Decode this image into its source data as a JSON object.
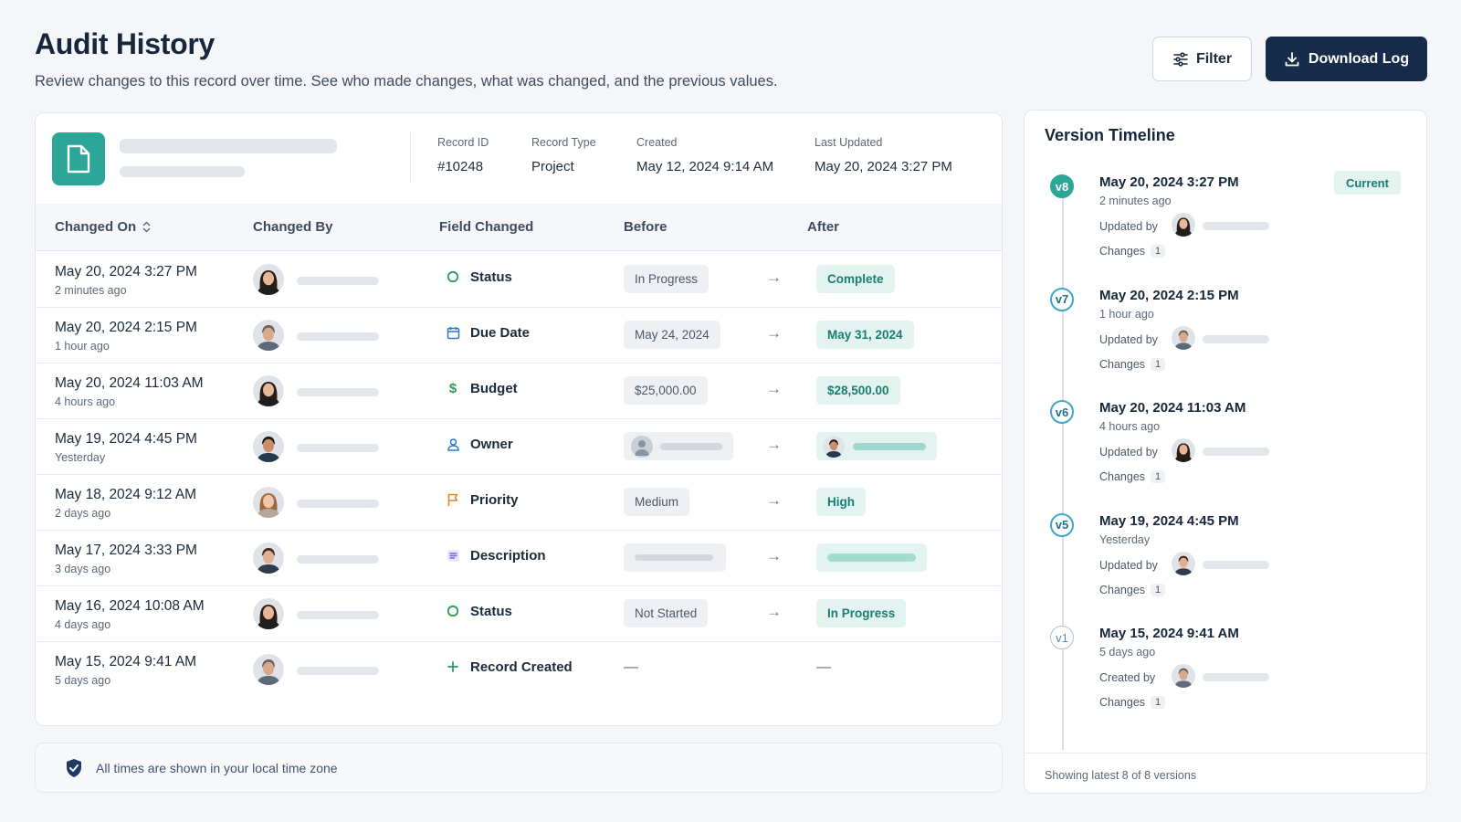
{
  "header": {
    "title": "Audit History",
    "subtitle": "Review changes to this record over time. See who made changes, what was changed, and the previous values.",
    "filter_label": "Filter",
    "download_label": "Download Log"
  },
  "record": {
    "icon": "document-icon",
    "meta": [
      {
        "label": "Record ID",
        "value": "#10248"
      },
      {
        "label": "Record Type",
        "value": "Project"
      },
      {
        "label": "Created",
        "value": "May 12, 2024 9:14 AM"
      },
      {
        "label": "Last Updated",
        "value": "May 20, 2024 3:27 PM"
      }
    ]
  },
  "table": {
    "columns": [
      "Changed On",
      "Changed By",
      "Field Changed",
      "Before",
      "After"
    ],
    "rows": [
      {
        "date": "May 20, 2024 3:27 PM",
        "ago": "2 minutes ago",
        "field": "Status",
        "icon": "status-circle-icon",
        "before": "In Progress",
        "after": "Complete"
      },
      {
        "date": "May 20, 2024 2:15 PM",
        "ago": "1 hour ago",
        "field": "Due Date",
        "icon": "calendar-icon",
        "before": "May 24, 2024",
        "after": "May 31, 2024"
      },
      {
        "date": "May 20, 2024 11:03 AM",
        "ago": "4 hours ago",
        "field": "Budget",
        "icon": "dollar-icon",
        "before": "$25,000.00",
        "after": "$28,500.00"
      },
      {
        "date": "May 19, 2024 4:45 PM",
        "ago": "Yesterday",
        "field": "Owner",
        "icon": "user-icon",
        "before": "",
        "after": ""
      },
      {
        "date": "May 18, 2024 9:12 AM",
        "ago": "2 days ago",
        "field": "Priority",
        "icon": "flag-icon",
        "before": "Medium",
        "after": "High"
      },
      {
        "date": "May 17, 2024 3:33 PM",
        "ago": "3 days ago",
        "field": "Description",
        "icon": "text-lines-icon",
        "before": "",
        "after": ""
      },
      {
        "date": "May 16, 2024 10:08 AM",
        "ago": "4 days ago",
        "field": "Status",
        "icon": "status-circle-icon",
        "before": "Not Started",
        "after": "In Progress"
      },
      {
        "date": "May 15, 2024 9:41 AM",
        "ago": "5 days ago",
        "field": "Record Created",
        "icon": "plus-icon",
        "before": "—",
        "after": "—"
      }
    ]
  },
  "footer_note": "All times are shown in your local time zone",
  "timeline": {
    "title": "Version Timeline",
    "current_label": "Current",
    "versions": [
      {
        "badge": "v8",
        "date": "May 20, 2024 3:27 PM",
        "ago": "2 minutes ago",
        "by_label": "Updated by",
        "changes_label": "Changes",
        "changes": "1"
      },
      {
        "badge": "v7",
        "date": "May 20, 2024 2:15 PM",
        "ago": "1 hour ago",
        "by_label": "Updated by",
        "changes_label": "Changes",
        "changes": "1"
      },
      {
        "badge": "v6",
        "date": "May 20, 2024 11:03 AM",
        "ago": "4 hours ago",
        "by_label": "Updated by",
        "changes_label": "Changes",
        "changes": "1"
      },
      {
        "badge": "v5",
        "date": "May 19, 2024 4:45 PM",
        "ago": "Yesterday",
        "by_label": "Updated by",
        "changes_label": "Changes",
        "changes": "1"
      },
      {
        "badge": "v1",
        "date": "May 15, 2024 9:41 AM",
        "ago": "5 days ago",
        "by_label": "Created by",
        "changes_label": "Changes",
        "changes": "1"
      }
    ],
    "footer": "Showing latest 8 of 8 versions"
  },
  "colors": {
    "accent": "#2ba698",
    "primary_button": "#172c4a",
    "after_pill_bg": "#e3f4f0",
    "after_pill_text": "#1b7d6f"
  }
}
